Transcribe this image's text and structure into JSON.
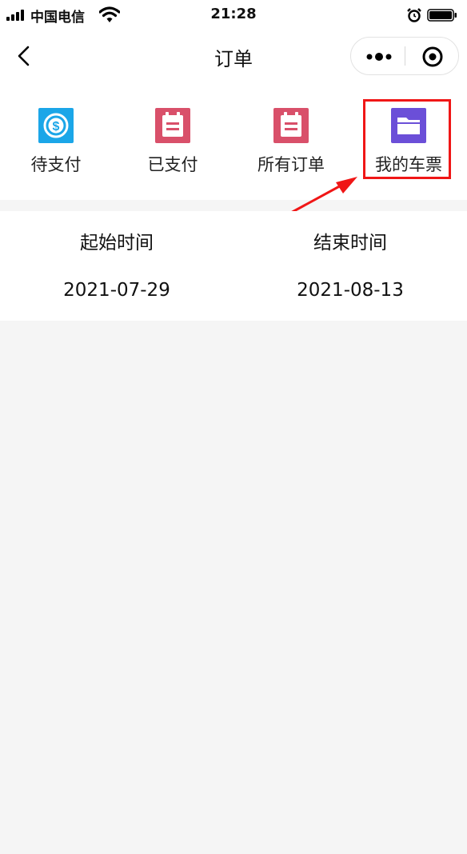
{
  "status_bar": {
    "carrier": "中国电信",
    "time": "21:28",
    "icons": [
      "signal-icon",
      "wifi-icon",
      "alarm-icon",
      "battery-icon"
    ]
  },
  "nav": {
    "title": "订单",
    "icons": [
      "back-icon",
      "more-icon",
      "capsule-close-icon"
    ]
  },
  "tabs": [
    {
      "label": "待支付",
      "icon": "dollar-circle-icon",
      "color": "#1ba6e8"
    },
    {
      "label": "已支付",
      "icon": "notepad-icon",
      "color": "#d9506a"
    },
    {
      "label": "所有订单",
      "icon": "notepad-icon",
      "color": "#d9506a"
    },
    {
      "label": "我的车票",
      "icon": "folder-icon",
      "color": "#6b4fd8"
    }
  ],
  "date_range": {
    "start_label": "起始时间",
    "start_value": "2021-07-29",
    "end_label": "结束时间",
    "end_value": "2021-08-13"
  },
  "annotation": {
    "color": "#f01616"
  }
}
